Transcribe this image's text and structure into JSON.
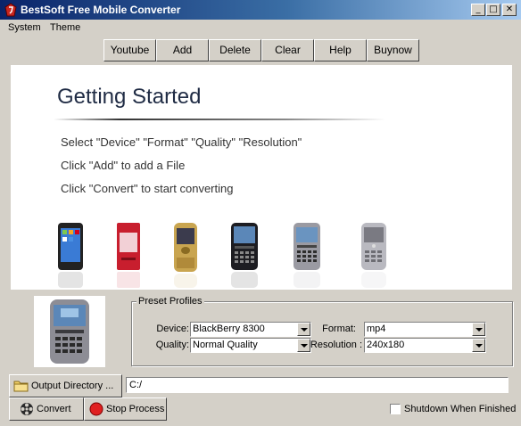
{
  "window": {
    "title": "BestSoft Free Mobile Converter"
  },
  "titlebar_buttons": {
    "minimize": "_",
    "maximize": "□",
    "close": "✕"
  },
  "menu": [
    {
      "label": "System"
    },
    {
      "label": "Theme"
    }
  ],
  "toolbar": [
    "Youtube",
    "Add",
    "Delete",
    "Clear",
    "Help",
    "Buynow"
  ],
  "getting_started": {
    "heading": "Getting Started",
    "lines": [
      "Select \"Device\" \"Format\" \"Quality\" \"Resolution\"",
      "Click  \"Add\" to add a File",
      "Click  \"Convert\" to start converting"
    ]
  },
  "phones": [
    "iphone",
    "red-flip-phone",
    "gold-slider-phone",
    "blackberry-curve-black",
    "blackberry-curve-silver",
    "blackberry-pearl-silver"
  ],
  "preset": {
    "title": "Preset Profiles",
    "device_label": "Device:",
    "device_value": "BlackBerry 8300",
    "format_label": "Format:",
    "format_value": "mp4",
    "quality_label": "Quality:",
    "quality_value": "Normal Quality",
    "resolution_label": "Resolution :",
    "resolution_value": "240x180"
  },
  "output": {
    "button_label": "Output Directory ...",
    "path": "C:/"
  },
  "actions": {
    "convert": "Convert",
    "stop": "Stop Process"
  },
  "shutdown_label": "Shutdown When Finished",
  "shutdown_checked": false
}
